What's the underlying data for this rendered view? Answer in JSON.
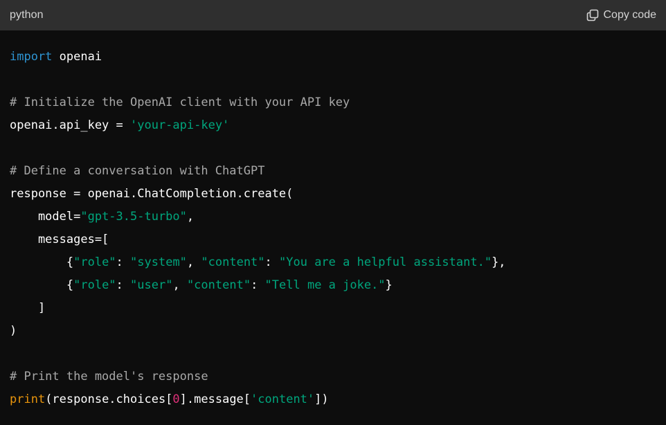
{
  "header": {
    "language": "python",
    "copy_label": "Copy code"
  },
  "colors": {
    "header_bg": "#2f2f2f",
    "code_bg": "#0d0d0d",
    "keyword": "#2e95d3",
    "comment": "#a8a8a8",
    "string": "#00a67d",
    "function": "#e9950c",
    "number": "#df3079",
    "text": "#ffffff"
  },
  "icons": {
    "copy": "copy-icon"
  },
  "code_lines": [
    [
      {
        "t": "kw",
        "v": "import"
      },
      {
        "t": "plain",
        "v": " openai"
      }
    ],
    [],
    [
      {
        "t": "cmt",
        "v": "# Initialize the OpenAI client with your API key"
      }
    ],
    [
      {
        "t": "plain",
        "v": "openai.api_key = "
      },
      {
        "t": "str",
        "v": "'your-api-key'"
      }
    ],
    [],
    [
      {
        "t": "cmt",
        "v": "# Define a conversation with ChatGPT"
      }
    ],
    [
      {
        "t": "plain",
        "v": "response = openai.ChatCompletion.create("
      }
    ],
    [
      {
        "t": "plain",
        "v": "    model="
      },
      {
        "t": "str",
        "v": "\"gpt-3.5-turbo\""
      },
      {
        "t": "plain",
        "v": ","
      }
    ],
    [
      {
        "t": "plain",
        "v": "    messages=["
      }
    ],
    [
      {
        "t": "plain",
        "v": "        {"
      },
      {
        "t": "str",
        "v": "\"role\""
      },
      {
        "t": "plain",
        "v": ": "
      },
      {
        "t": "str",
        "v": "\"system\""
      },
      {
        "t": "plain",
        "v": ", "
      },
      {
        "t": "str",
        "v": "\"content\""
      },
      {
        "t": "plain",
        "v": ": "
      },
      {
        "t": "str",
        "v": "\"You are a helpful assistant.\""
      },
      {
        "t": "plain",
        "v": "},"
      }
    ],
    [
      {
        "t": "plain",
        "v": "        {"
      },
      {
        "t": "str",
        "v": "\"role\""
      },
      {
        "t": "plain",
        "v": ": "
      },
      {
        "t": "str",
        "v": "\"user\""
      },
      {
        "t": "plain",
        "v": ", "
      },
      {
        "t": "str",
        "v": "\"content\""
      },
      {
        "t": "plain",
        "v": ": "
      },
      {
        "t": "str",
        "v": "\"Tell me a joke.\""
      },
      {
        "t": "plain",
        "v": "}"
      }
    ],
    [
      {
        "t": "plain",
        "v": "    ]"
      }
    ],
    [
      {
        "t": "plain",
        "v": ")"
      }
    ],
    [],
    [
      {
        "t": "cmt",
        "v": "# Print the model's response"
      }
    ],
    [
      {
        "t": "fn",
        "v": "print"
      },
      {
        "t": "plain",
        "v": "(response.choices["
      },
      {
        "t": "num",
        "v": "0"
      },
      {
        "t": "plain",
        "v": "].message["
      },
      {
        "t": "str",
        "v": "'content'"
      },
      {
        "t": "plain",
        "v": "])"
      }
    ]
  ]
}
